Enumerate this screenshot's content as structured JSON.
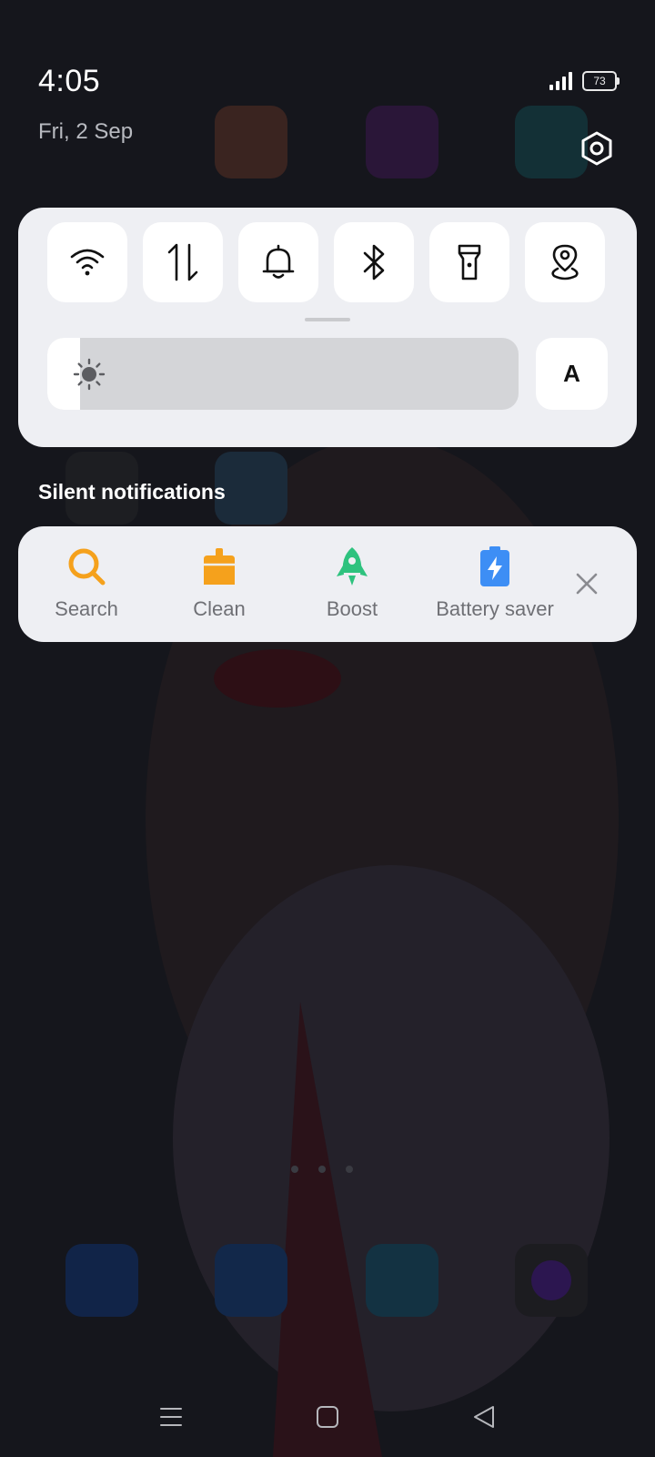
{
  "status_bar": {
    "time": "4:05",
    "date": "Fri, 2 Sep",
    "battery_level": "73",
    "icons": [
      "signal-icon",
      "battery-icon"
    ]
  },
  "quick_settings": {
    "tiles": [
      {
        "name": "wifi",
        "icon": "wifi-icon"
      },
      {
        "name": "mobile-data",
        "icon": "mobile-data-icon"
      },
      {
        "name": "sound",
        "icon": "bell-icon"
      },
      {
        "name": "bluetooth",
        "icon": "bluetooth-icon"
      },
      {
        "name": "flashlight",
        "icon": "flashlight-icon"
      },
      {
        "name": "location",
        "icon": "location-icon"
      }
    ],
    "brightness_level": 0.07,
    "auto_brightness_label": "A",
    "settings_icon": "gear-icon"
  },
  "silent_notifications": {
    "title": "Silent notifications",
    "actions": [
      {
        "label": "Search",
        "icon": "search-icon",
        "color": "#f5a11c"
      },
      {
        "label": "Clean",
        "icon": "broom-icon",
        "color": "#f5a11c"
      },
      {
        "label": "Boost",
        "icon": "rocket-icon",
        "color": "#2ec27e"
      },
      {
        "label": "Battery saver",
        "icon": "battery-saver-icon",
        "color": "#3d8ef5"
      }
    ],
    "dismiss_icon": "close-icon"
  },
  "nav_bar": {
    "buttons": [
      "menu-icon",
      "home-icon",
      "back-icon"
    ]
  },
  "colors": {
    "panel_bg": "#eeeff3",
    "tile_bg": "#ffffff",
    "accent_orange": "#f5a11c",
    "accent_green": "#2ec27e",
    "accent_blue": "#3d8ef5"
  }
}
